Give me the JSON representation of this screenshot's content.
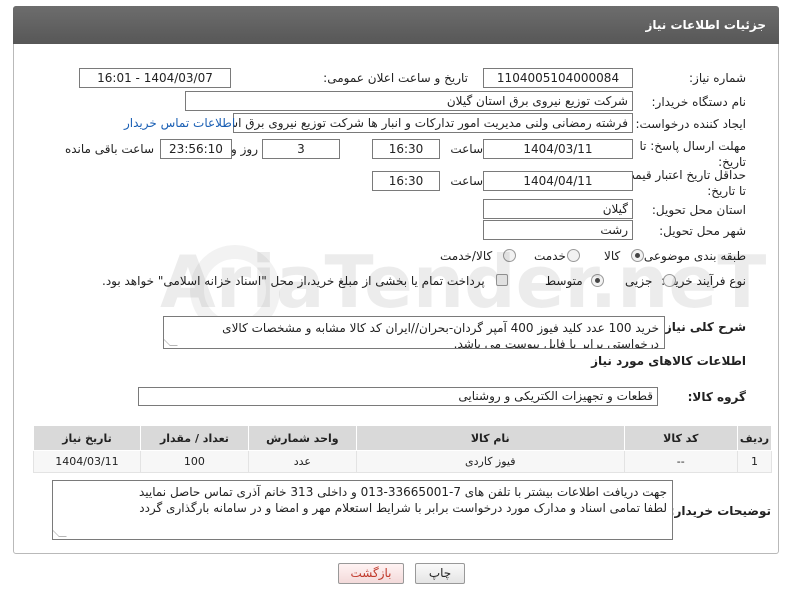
{
  "header": {
    "title": "جزئیات اطلاعات نیاز"
  },
  "form": {
    "need_number_label": "شماره نیاز:",
    "need_number": "1104005104000084",
    "announce_label": "تاریخ و ساعت اعلان عمومی:",
    "announce_value": "1404/03/07 - 16:01",
    "buyer_org_label": "نام دستگاه خریدار:",
    "buyer_org": "شرکت توزیع نیروی برق استان گیلان",
    "creator_label": "ایجاد کننده درخواست:",
    "creator": "فرشته رمضانی ولنی مدیریت امور تدارکات و انبار ها شرکت توزیع نیروی برق استان",
    "contact_link": "اطلاعات تماس خریدار",
    "reply_deadline_label": "مهلت ارسال پاسخ: تا تاریخ:",
    "reply_date": "1404/03/11",
    "time_label": "ساعت",
    "reply_time": "16:30",
    "days_value": "3",
    "days_label": "روز و",
    "remaining_time": "23:56:10",
    "remaining_label": "ساعت باقی مانده",
    "price_deadline_label": "حداقل تاریخ اعتبار قیمت: تا تاریخ:",
    "price_date": "1404/04/11",
    "price_time_label": "ساعت",
    "price_time": "16:30",
    "province_label": "استان محل تحویل:",
    "province": "گیلان",
    "city_label": "شهر محل تحویل:",
    "city": "رشت",
    "category_label": "طبقه بندی موضوعی:",
    "category_options": [
      "کالا",
      "خدمت",
      "کالا/خدمت"
    ],
    "process_label": "نوع فرآیند خرید :",
    "process_options": [
      "جزیی",
      "متوسط"
    ],
    "payment_note": "پرداخت تمام یا بخشی از مبلغ خرید،از محل \"اسناد خزانه اسلامی\" خواهد بود.",
    "description_label": "شرح کلی نیاز:",
    "description": "خرید 100 عدد کلید فیوز 400 آمپر گردان-بحران//ایران کد کالا مشابه و مشخصات کالای درخواستی برابر با فایل پیوست می باشد."
  },
  "goods": {
    "section_title": "اطلاعات کالاهای مورد نیاز",
    "group_label": "گروه کالا:",
    "group_value": "قطعات و تجهیزات الکتریکی و روشنایی",
    "columns": [
      "ردیف",
      "کد کالا",
      "نام کالا",
      "واحد شمارش",
      "تعداد / مقدار",
      "تاریخ نیاز"
    ],
    "rows": [
      {
        "row": "1",
        "code": "--",
        "name": "فیوز کاردی",
        "unit": "عدد",
        "qty": "100",
        "date": "1404/03/11"
      }
    ]
  },
  "buyer_notes": {
    "label": "توضیحات خریدار:",
    "line1": "جهت دریافت اطلاعات بیشتر با تلفن های 7-33665001-013 و داخلی 313 خانم آذری تماس حاصل نمایید",
    "line2": "لطفا تمامی اسناد و مدارک مورد درخواست برابر با شرایط استعلام مهر و امضا و در سامانه بارگذاری گردد"
  },
  "buttons": {
    "print": "چاپ",
    "back": "بازگشت"
  },
  "colors": {
    "header_bg": "#606060",
    "link": "#1a5fb4",
    "back_btn_text": "#c0392b"
  }
}
